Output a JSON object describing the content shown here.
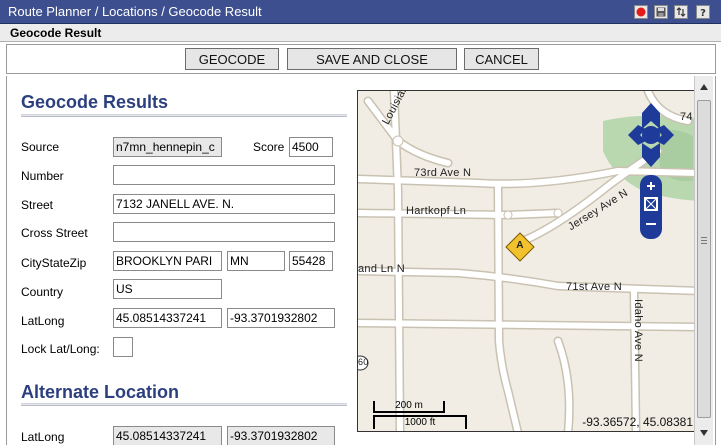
{
  "window": {
    "breadcrumb": "Route Planner / Locations / Geocode Result",
    "subtitle": "Geocode Result"
  },
  "toolbar": {
    "geocode_label": "GEOCODE",
    "save_close_label": "SAVE AND CLOSE",
    "cancel_label": "CANCEL"
  },
  "geocode_results": {
    "heading": "Geocode Results",
    "source": {
      "label": "Source",
      "value": "n7mn_hennepin_c"
    },
    "score": {
      "label": "Score",
      "value": "4500"
    },
    "number": {
      "label": "Number",
      "value": ""
    },
    "street": {
      "label": "Street",
      "value": "7132 JANELL AVE. N."
    },
    "cross_street": {
      "label": "Cross Street",
      "value": ""
    },
    "city_state_zip": {
      "label": "CityStateZip",
      "city": "BROOKLYN PARI",
      "state": "MN",
      "zip": "55428"
    },
    "country": {
      "label": "Country",
      "value": "US"
    },
    "latlong": {
      "label": "LatLong",
      "lat": "45.08514337241",
      "long": "-93.3701932802"
    },
    "lock": {
      "label": "Lock Lat/Long:"
    }
  },
  "alternate_location": {
    "heading": "Alternate Location",
    "latlong": {
      "label": "LatLong",
      "lat": "45.08514337241",
      "long": "-93.3701932802"
    }
  },
  "map": {
    "streets": {
      "louisiana": "Louisiana Ave",
      "ave73": "73rd Ave N",
      "hartkopf": "Hartkopf Ln",
      "jersey": "Jersey Ave N",
      "landn": "and Ln N",
      "ave71": "71st Ave N",
      "idaho": "Idaho Ave N",
      "num74": "74",
      "num60": "60"
    },
    "marker_letter": "A",
    "scale_m": "200 m",
    "scale_ft": "1000 ft",
    "coords": "-93.36572, 45.08381",
    "colors": {
      "road_fill": "#ffffff",
      "road_edge": "#c9c2b2",
      "park": "#b9d8b0",
      "marker": "#f2c12e",
      "nav": "#1f3b9a"
    }
  }
}
